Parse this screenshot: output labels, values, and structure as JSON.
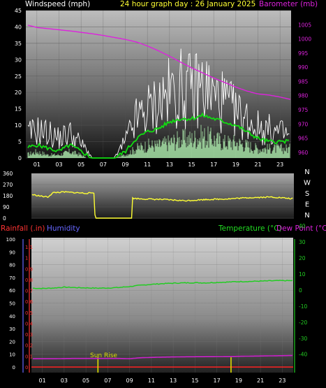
{
  "header": {
    "windspeed_label": "Windspeed (mph)",
    "title": "24 hour graph day : 26 January 2025",
    "barometer_label": "Barometer (mb)"
  },
  "panel2": {
    "compass": [
      "N",
      "W",
      "S",
      "E",
      "N"
    ]
  },
  "panel3": {
    "rainfall_label": "Rainfall (.in)",
    "humidity_label": "Humidity",
    "temperature_label": "Temperature (°C)",
    "dewpoint_label": "Dew Point (°C)",
    "sunrise_label": "Sun Rise"
  },
  "colors": {
    "barometer": "#dd22dd",
    "gust": "#ffffff",
    "wind_avg": "#11dd11",
    "wind_lower": "#bbffbb",
    "direction": "#ffff33",
    "temperature": "#22cc22",
    "dewpoint": "#cc22cc",
    "rain_axis": "#ff3333",
    "humidity_axis": "#6666ff",
    "sun": "#dddd00"
  },
  "chart_data": [
    {
      "type": "line",
      "name": "wind-and-barometer",
      "x_ticks": [
        "01",
        "03",
        "05",
        "07",
        "09",
        "11",
        "13",
        "15",
        "17",
        "19",
        "21",
        "23"
      ],
      "x_range_hours": [
        0,
        24
      ],
      "ylabel": "Windspeed (mph)",
      "y_ticks": [
        0,
        5,
        10,
        15,
        20,
        25,
        30,
        35,
        40,
        45
      ],
      "ylim": [
        0,
        45
      ],
      "y2label": "Barometer (mb)",
      "y2_ticks": [
        960,
        965,
        970,
        975,
        980,
        985,
        990,
        995,
        1000,
        1005
      ],
      "y2lim": [
        958,
        1010
      ],
      "series": [
        {
          "name": "Barometer (mb)",
          "axis": "right",
          "x": [
            0,
            1,
            2,
            3,
            4,
            5,
            6,
            7,
            8,
            9,
            10,
            11,
            12,
            13,
            14,
            15,
            16,
            17,
            18,
            19,
            20,
            21,
            22,
            23,
            24
          ],
          "values": [
            1005,
            1004,
            1003.6,
            1003.2,
            1002.8,
            1002.3,
            1001.8,
            1001.2,
            1000.5,
            999.8,
            998.9,
            997.5,
            995.8,
            993.9,
            991.8,
            989.8,
            988.0,
            986.2,
            984.6,
            983.0,
            981.6,
            980.6,
            980.2,
            979.5,
            978.6
          ]
        },
        {
          "name": "gust",
          "axis": "left",
          "x": [
            0,
            1,
            2,
            3,
            4,
            5,
            5.5,
            6,
            7,
            8,
            9,
            10,
            11,
            12,
            13,
            14,
            15,
            16,
            17,
            18,
            19,
            20,
            21,
            22,
            23,
            24
          ],
          "values": [
            8,
            10,
            9,
            7,
            9,
            5,
            3,
            0,
            0,
            0,
            6,
            14,
            17,
            20,
            23,
            25,
            24,
            26,
            22,
            20,
            16,
            14,
            11,
            10,
            9,
            8
          ]
        },
        {
          "name": "average",
          "axis": "left",
          "x": [
            0,
            1,
            2,
            3,
            4,
            5,
            5.5,
            6,
            7,
            8,
            9,
            10,
            11,
            12,
            13,
            14,
            15,
            16,
            17,
            18,
            19,
            20,
            21,
            22,
            23,
            24
          ],
          "values": [
            3,
            4,
            3,
            2,
            4,
            2,
            1,
            0,
            0,
            0,
            2,
            6,
            8,
            9,
            11,
            12,
            12,
            13,
            12,
            11,
            10,
            8,
            6,
            5,
            5,
            5
          ]
        },
        {
          "name": "lower",
          "axis": "left",
          "x": [
            0,
            1,
            2,
            3,
            4,
            5,
            5.5,
            6,
            7,
            8,
            9,
            10,
            11,
            12,
            13,
            14,
            15,
            16,
            17,
            18,
            19,
            20,
            21,
            22,
            23,
            24
          ],
          "values": [
            1,
            2,
            1,
            1,
            2,
            1,
            0,
            0,
            0,
            0,
            1,
            3,
            4,
            4,
            5,
            6,
            6,
            7,
            6,
            5,
            5,
            4,
            3,
            3,
            3,
            3
          ]
        }
      ]
    },
    {
      "type": "line",
      "name": "wind-direction",
      "x_range_hours": [
        0,
        24
      ],
      "y_ticks": [
        0,
        90,
        180,
        270,
        360
      ],
      "ylim": [
        0,
        360
      ],
      "series": [
        {
          "name": "direction",
          "x": [
            0,
            1,
            1.5,
            2,
            3,
            4,
            5,
            5.8,
            5.81,
            9.2,
            9.21,
            10,
            12,
            14,
            16,
            18,
            20,
            22,
            24
          ],
          "values": [
            190,
            175,
            170,
            205,
            210,
            205,
            200,
            205,
            0,
            0,
            160,
            155,
            150,
            140,
            150,
            155,
            165,
            170,
            155
          ]
        }
      ]
    },
    {
      "type": "line",
      "name": "rain-humidity-temperature-dewpoint",
      "x_ticks": [
        "01",
        "03",
        "05",
        "07",
        "09",
        "11",
        "13",
        "15",
        "17",
        "19",
        "21",
        "23"
      ],
      "x_range_hours": [
        0,
        24
      ],
      "humidity_ticks": [
        0,
        10,
        20,
        30,
        40,
        50,
        60,
        70,
        80,
        90,
        100
      ],
      "humidity_lim": [
        0,
        100
      ],
      "rain_ticks": [
        0,
        0.1,
        0.2,
        0.3,
        0.4,
        0.5,
        0.6,
        0.7,
        0.8,
        0.9,
        1,
        1.1
      ],
      "rain_lim": [
        0,
        1.19
      ],
      "temp_ticks": [
        -40,
        -30,
        -20,
        -10,
        0,
        10,
        20,
        30,
        40
      ],
      "temp_lim": [
        -48,
        42
      ],
      "sunrise_hour": 6.1,
      "sunset_hour": 18.3,
      "series": [
        {
          "name": "Temperature (°C)",
          "x": [
            0,
            1,
            2,
            3,
            4,
            5,
            6,
            7,
            8,
            9,
            10,
            11,
            12,
            13,
            14,
            15,
            16,
            17,
            18,
            19,
            20,
            21,
            22,
            23,
            24
          ],
          "values": [
            1.2,
            1.0,
            1.3,
            1.8,
            1.6,
            1.4,
            1.2,
            1.3,
            1.6,
            2.2,
            3.0,
            3.6,
            4.0,
            4.3,
            4.5,
            4.6,
            4.5,
            4.8,
            5.0,
            5.3,
            5.4,
            5.6,
            5.8,
            5.9,
            5.9
          ]
        },
        {
          "name": "Dew Point (°C)",
          "x": [
            0,
            2,
            4,
            6,
            8,
            9,
            10,
            12,
            14,
            16,
            18,
            20,
            22,
            24
          ],
          "values": [
            -42.8,
            -42.8,
            -42.6,
            -42.6,
            -42.6,
            -42.8,
            -42.2,
            -41.8,
            -41.6,
            -41.5,
            -41.4,
            -41.2,
            -41.0,
            -40.8
          ]
        }
      ]
    }
  ]
}
